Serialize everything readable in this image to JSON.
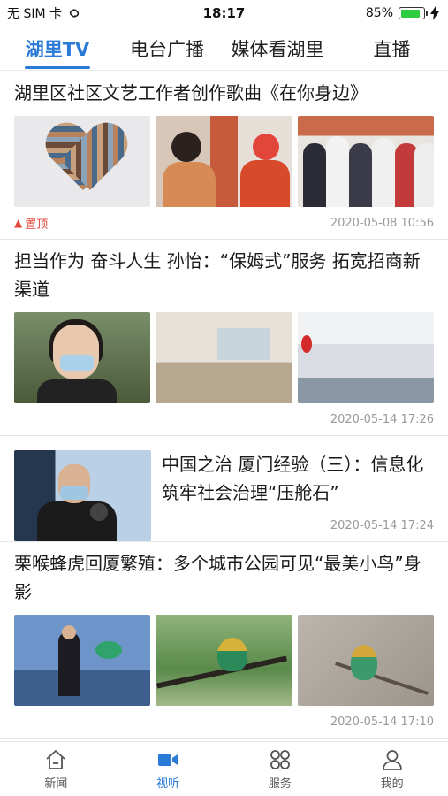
{
  "status": {
    "carrier": "无 SIM 卡",
    "time": "18:17",
    "battery_percent": "85%",
    "battery_level": 0.85
  },
  "tabs": [
    {
      "label": "湖里TV",
      "active": true
    },
    {
      "label": "电台广播",
      "active": false
    },
    {
      "label": "媒体看湖里",
      "active": false
    },
    {
      "label": "直播",
      "active": false
    }
  ],
  "feed": [
    {
      "title": "湖里区社区文艺工作者创作歌曲《在你身边》",
      "badge": "置顶",
      "time": "2020-05-08 10:56"
    },
    {
      "title": "担当作为 奋斗人生 孙怡：“保姆式”服务 拓宽招商新渠道",
      "time": "2020-05-14 17:26"
    },
    {
      "title": "中国之治 厦门经验（三）：信息化筑牢社会治理“压舱石”",
      "time": "2020-05-14 17:24"
    },
    {
      "title": "栗喉蜂虎回厦繁殖：多个城市公园可见“最美小鸟”身影",
      "time": "2020-05-14 17:10"
    }
  ],
  "bottom_nav": [
    {
      "label": "新闻",
      "icon": "home-icon",
      "active": false
    },
    {
      "label": "视听",
      "icon": "video-camera-icon",
      "active": true
    },
    {
      "label": "服务",
      "icon": "grid-icon",
      "active": false
    },
    {
      "label": "我的",
      "icon": "user-icon",
      "active": false
    }
  ],
  "colors": {
    "accent": "#2a7ad6",
    "pin": "#e2453a",
    "battery": "#2ecc40"
  }
}
